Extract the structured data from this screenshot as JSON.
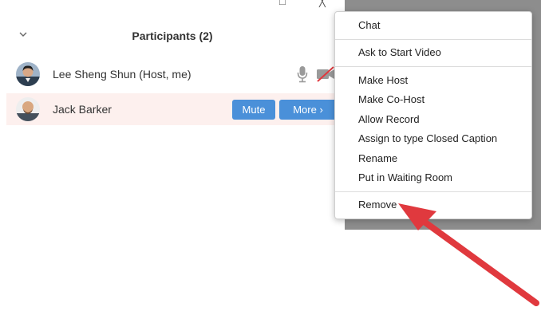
{
  "window": {
    "minimize_icon": "□",
    "close_icon": "╳"
  },
  "header": {
    "title": "Participants (2)",
    "collapse_icon": "chevron-down-icon"
  },
  "participants": [
    {
      "name": "Lee Sheng Shun (Host, me)",
      "mic": "muted-mic-icon",
      "video": "video-off-icon"
    },
    {
      "name": "Jack Barker",
      "mute_label": "Mute",
      "more_label": "More ›"
    }
  ],
  "context_menu": {
    "items": [
      {
        "label": "Chat"
      },
      {
        "label": "Ask to Start Video"
      },
      {
        "label": "Make Host"
      },
      {
        "label": "Make Co-Host"
      },
      {
        "label": "Allow Record"
      },
      {
        "label": "Assign to type Closed Caption"
      },
      {
        "label": "Rename"
      },
      {
        "label": "Put in Waiting Room"
      },
      {
        "label": "Remove"
      }
    ]
  },
  "colors": {
    "button_blue": "#4a90d9",
    "selected_row": "#fdf0ee",
    "annotation_arrow": "#e0393e",
    "backdrop_gray": "#8d8d8d"
  }
}
